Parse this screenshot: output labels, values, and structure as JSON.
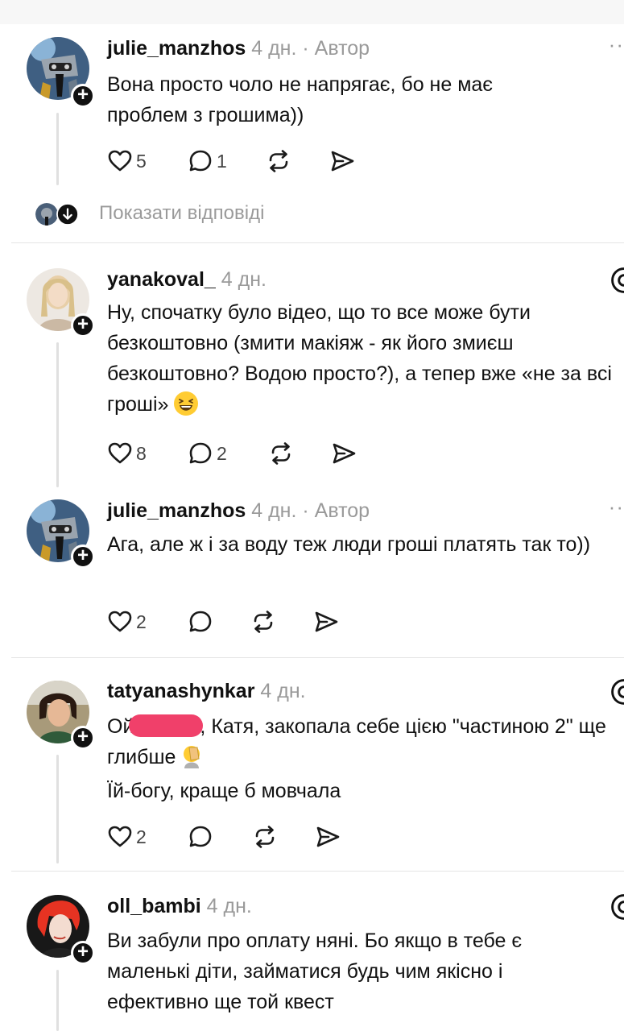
{
  "colors": {
    "redaction": "#f0406a",
    "text": "#111111",
    "meta": "#9a9a9a"
  },
  "posts": [
    {
      "username": "julie_manzhos",
      "time": "4 дн.",
      "separator": "·",
      "author_tag": "Автор",
      "text": "Вона просто чоло не напрягає, бо не має проблем з грошима))",
      "likes": "5",
      "replies": "1",
      "show_replies": "Показати відповіді"
    },
    {
      "username": "yanakoval_",
      "time": "4 дн.",
      "text": "Ну, спочатку було відео, що то все може бути безкоштовно (змити макіяж - як його змиєш безкоштовно? Водою просто?), а тепер вже «не за всі гроші»",
      "emoji": "grinning-squinting-face",
      "likes": "8",
      "replies": "2"
    },
    {
      "username": "julie_manzhos",
      "time": "4 дн.",
      "separator": "·",
      "author_tag": "Автор",
      "text": "Ага, але ж і за воду теж люди гроші платять так то))",
      "likes": "2"
    },
    {
      "username": "tatyanashynkar",
      "time": "4 дн.",
      "text_before": "Ой",
      "text_after": ", Катя, закопала себе цією \"частиною 2\" ще глибше",
      "emoji": "face-palm",
      "text_line2": "Їй-богу, краще б мовчала",
      "likes": "2"
    },
    {
      "username": "oll_bambi",
      "time": "4 дн.",
      "text": "Ви забули про оплату няні. Бо якщо в тебе є маленькі діти, займатися будь чим якісно і ефективно ще той квест"
    }
  ]
}
